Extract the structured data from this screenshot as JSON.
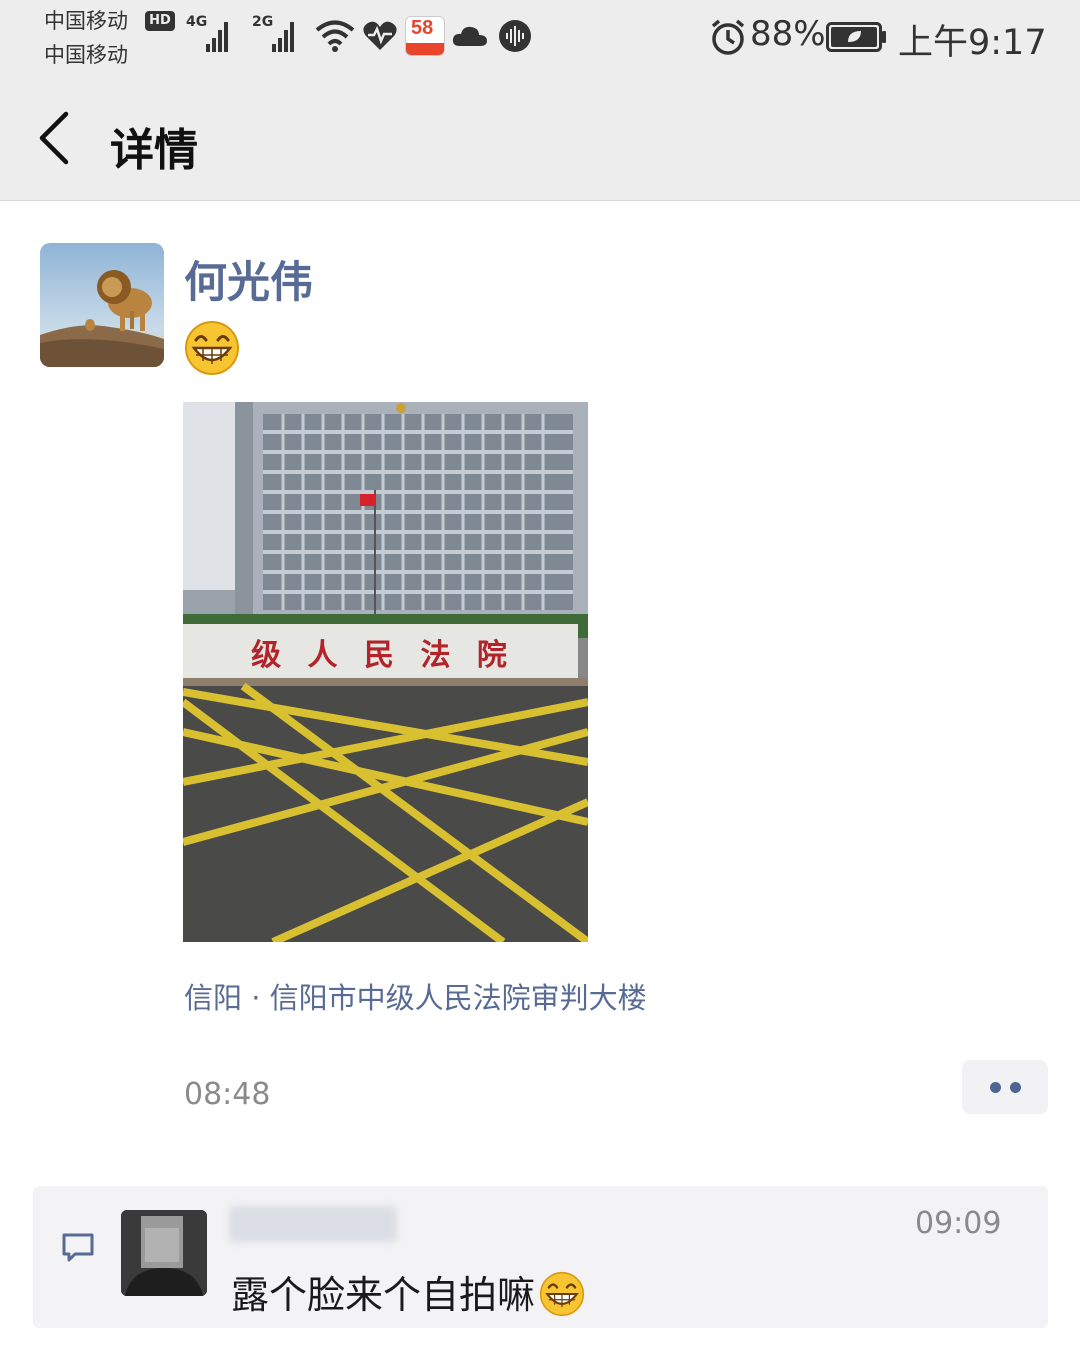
{
  "status_bar": {
    "carrier_1": "中国移动",
    "carrier_2": "中国移动",
    "hd_badge": "HD",
    "network_1": "4G",
    "network_2": "2G",
    "app_badge": "58",
    "battery": "88%",
    "time": "上午9:17",
    "icons": [
      "signal-icon",
      "wifi-icon",
      "heart-rate-icon",
      "app-58-icon",
      "cloud-icon",
      "audio-icon",
      "alarm-icon",
      "battery-icon"
    ]
  },
  "header": {
    "back_icon": "chevron-left-icon",
    "title": "详情"
  },
  "post": {
    "author": "何光伟",
    "emoji": "grinning-face-icon",
    "photo_sign_text": "级 人 民 法 院",
    "location": "信阳 · 信阳市中级人民法院审判大楼",
    "time": "08:48",
    "more_icon": "more-dots-icon"
  },
  "comments": {
    "icon": "comment-icon",
    "items": [
      {
        "name": "123",
        "time": "09:09",
        "text": "露个脸来个自拍嘛",
        "emoji": "grinning-face-icon"
      }
    ]
  },
  "colors": {
    "link_blue": "#576b95",
    "bar_gray": "#ededed",
    "panel_gray": "#f3f3f5",
    "dot_blue": "#4d6594"
  }
}
